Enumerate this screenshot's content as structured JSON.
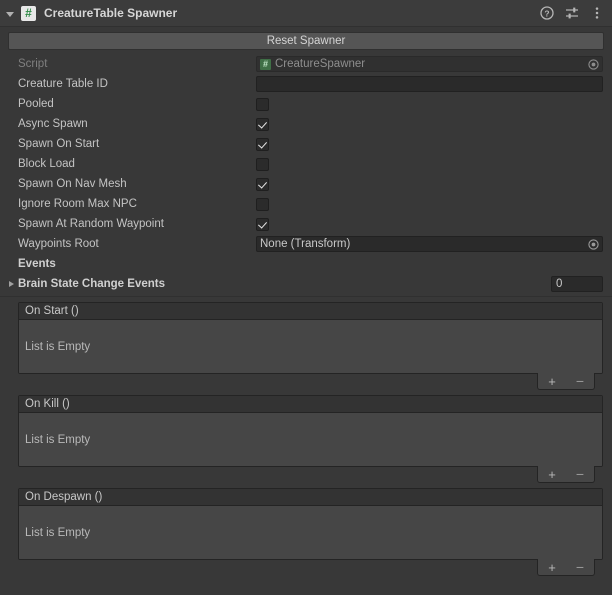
{
  "titlebar": {
    "component_name": "CreatureTable Spawner",
    "script_badge": "#",
    "foldout_state": "expanded",
    "icons": [
      {
        "name": "help-icon",
        "glyph": "?"
      },
      {
        "name": "preset-icon",
        "glyph": "preset"
      },
      {
        "name": "more-menu-icon",
        "glyph": "⋮"
      }
    ]
  },
  "toolbar": {
    "reset_label": "Reset Spawner"
  },
  "properties": [
    {
      "label": "Script",
      "type": "object",
      "value": "CreatureSpawner",
      "disabled": true,
      "name": "script-field"
    },
    {
      "label": "Creature Table ID",
      "type": "text",
      "value": "",
      "placeholder": "",
      "disabled": false,
      "name": "creature-table-id-field"
    },
    {
      "label": "Pooled",
      "type": "checkbox",
      "checked": false,
      "name": "pooled-checkbox"
    },
    {
      "label": "Async Spawn",
      "type": "checkbox",
      "checked": true,
      "name": "async-spawn-checkbox"
    },
    {
      "label": "Spawn On Start",
      "type": "checkbox",
      "checked": true,
      "name": "spawn-on-start-checkbox"
    },
    {
      "label": "Block Load",
      "type": "checkbox",
      "checked": false,
      "name": "block-load-checkbox"
    },
    {
      "label": "Spawn On Nav Mesh",
      "type": "checkbox",
      "checked": true,
      "name": "spawn-on-nav-mesh-checkbox"
    },
    {
      "label": "Ignore Room Max NPC",
      "type": "checkbox",
      "checked": false,
      "name": "ignore-room-max-npc-checkbox"
    },
    {
      "label": "Spawn At Random Waypoint",
      "type": "checkbox",
      "checked": true,
      "name": "spawn-at-random-waypoint-checkbox"
    },
    {
      "label": "Waypoints Root",
      "type": "object",
      "value": "None (Transform)",
      "disabled": false,
      "name": "waypoints-root-field"
    }
  ],
  "events_section": {
    "header": "Events",
    "array_row": {
      "label": "Brain State Change Events",
      "size": "0",
      "foldout_state": "collapsed"
    },
    "event_lists": [
      {
        "title": "On Start ()",
        "empty_text": "List is Empty",
        "add_label": "+",
        "remove_label": "−",
        "name": "on-start-event-list"
      },
      {
        "title": "On Kill ()",
        "empty_text": "List is Empty",
        "add_label": "+",
        "remove_label": "−",
        "name": "on-kill-event-list"
      },
      {
        "title": "On Despawn ()",
        "empty_text": "List is Empty",
        "add_label": "+",
        "remove_label": "−",
        "name": "on-despawn-event-list"
      }
    ]
  },
  "colors": {
    "window_background": "#383838",
    "titlebar_background": "#3c3c3c",
    "button_background": "#555555",
    "field_background": "#2a2a2a",
    "event_box_background": "#464646",
    "event_header_background": "#333333",
    "text_primary": "#c4c4c4",
    "text_disabled": "#7f7f7f",
    "script_icon_green": "#2f8a46"
  }
}
